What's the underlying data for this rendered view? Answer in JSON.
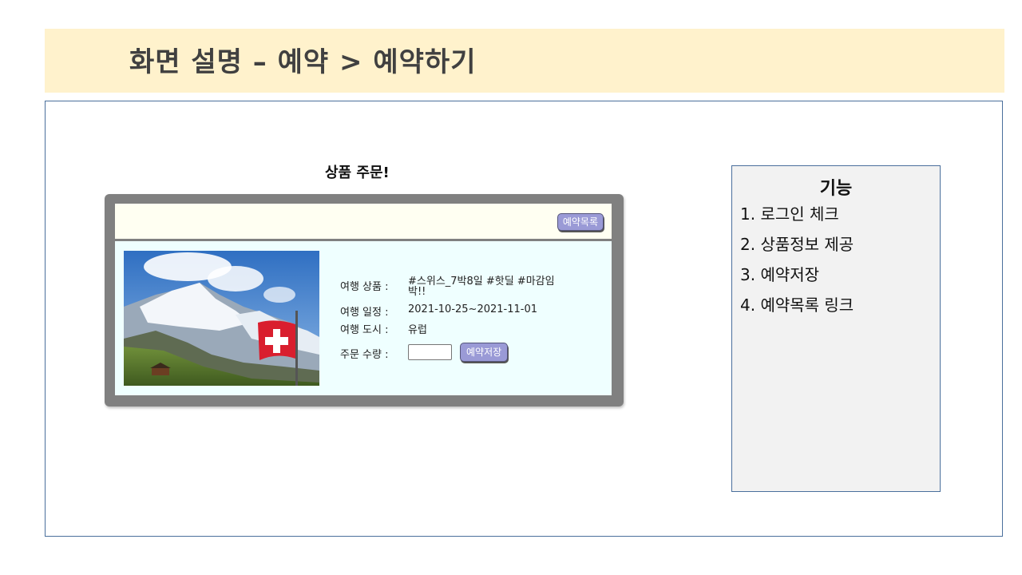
{
  "slide": {
    "title": "화면 설명 – 예약 > 예약하기"
  },
  "page": {
    "heading": "상품 주문!"
  },
  "card": {
    "list_button": "예약목록",
    "image_alt": "alpine-mountain-swiss-flag",
    "fields": {
      "product_label": "여행 상품 :",
      "product_value": "#스위스_7박8일 #핫딜 #마감임박!!",
      "schedule_label": "여행 일정 :",
      "schedule_value": "2021-10-25~2021-11-01",
      "city_label": "여행 도시 :",
      "city_value": "유럽",
      "quantity_label": "주문 수량 :",
      "quantity_value": ""
    },
    "save_button": "예약저장"
  },
  "features": {
    "title": "기능",
    "items": [
      "1. 로그인 체크",
      "2. 상품정보 제공",
      "3. 예약저장",
      "4. 예약목록 링크"
    ]
  },
  "colors": {
    "title_band": "#fff2cc",
    "frame_border": "#4a6f9c",
    "card_frame": "#808080",
    "card_top": "#fffff2",
    "card_body": "#efffff",
    "button": "#9a9ad6",
    "feature_box": "#f2f2f2"
  }
}
